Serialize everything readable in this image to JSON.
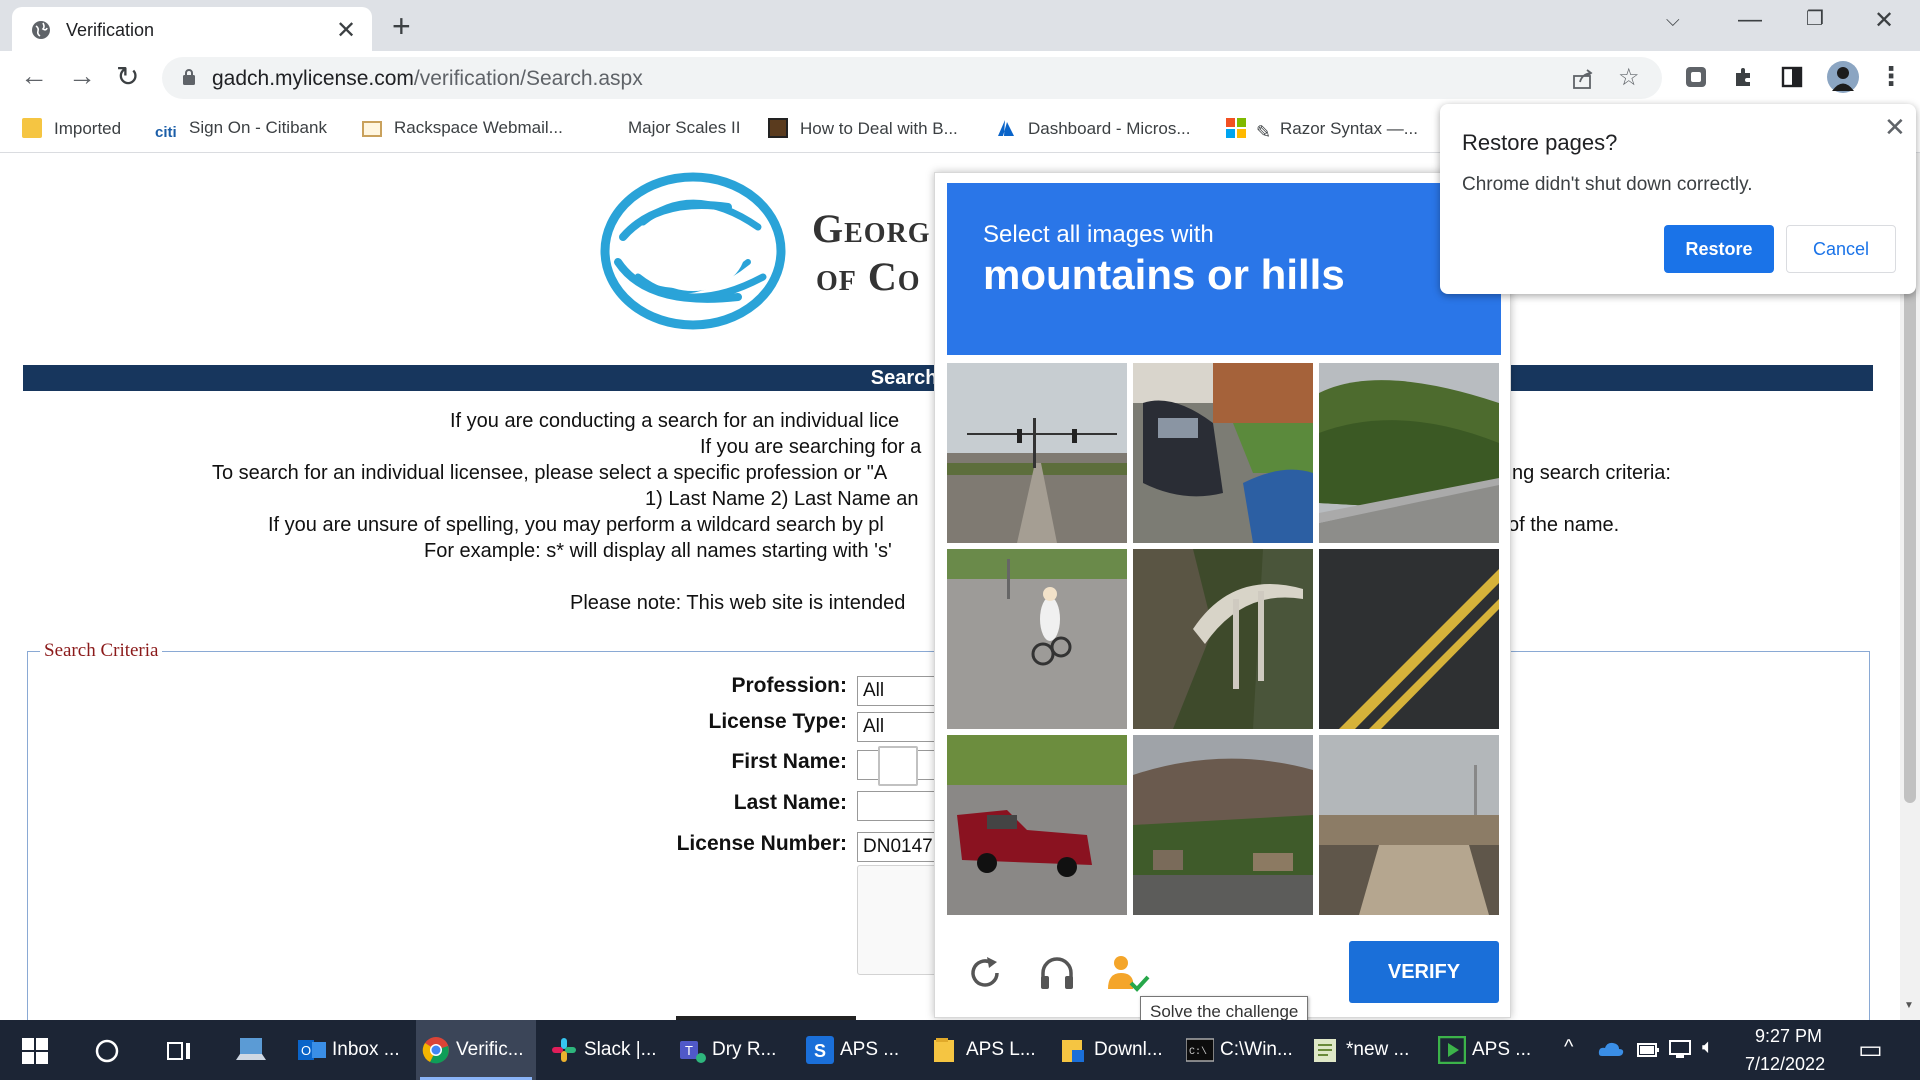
{
  "browser": {
    "tab_title": "Verification",
    "url_host": "gadch.mylicense.com",
    "url_path": "/verification/Search.aspx"
  },
  "bookmarks": [
    {
      "label": "Imported",
      "icon": "folder-icon"
    },
    {
      "label": "Sign On - Citibank",
      "icon": "citi-icon"
    },
    {
      "label": "Rackspace Webmail...",
      "icon": "mail-icon"
    },
    {
      "label": "Major Scales II",
      "icon": ""
    },
    {
      "label": "How to Deal with B...",
      "icon": "book-icon"
    },
    {
      "label": "Dashboard - Micros...",
      "icon": "azure-icon"
    },
    {
      "label": "Razor Syntax —...",
      "icon": "pen-icon"
    }
  ],
  "page": {
    "org_line1": "Georg",
    "org_line2": "of Co",
    "banner": "Search for a Pro",
    "intro": [
      "If you are conducting a search for an individual lice",
      "If you are searching for a",
      "To search for an individual licensee, please select a specific profession or \"A",
      "ng search criteria:",
      "1) Last Name 2) Last Name an",
      "If you are unsure of spelling, you may perform a wildcard search by pl",
      "of the name.",
      "For example: s* will display all names starting with 's'",
      "Please note: This web site is intended"
    ],
    "fieldset_legend": "Search Criteria",
    "fields": {
      "profession_label": "Profession:",
      "profession_value": "All",
      "license_type_label": "License Type:",
      "license_type_value": "All",
      "first_name_label": "First Name:",
      "first_name_value": "",
      "last_name_label": "Last Name:",
      "last_name_value": "",
      "license_number_label": "License Number:",
      "license_number_value": "DN0147"
    }
  },
  "captcha": {
    "prompt_pre": "Select all images with",
    "prompt_main": "mountains or hills",
    "verify_label": "VERIFY",
    "tooltip": "Solve the challenge",
    "tiles": [
      "road-traffic-light",
      "parked-cars",
      "green-hill",
      "cyclist-on-road",
      "bridge-canyon",
      "road-yellow-line",
      "red-pickup-truck",
      "town-with-hills",
      "overpass"
    ]
  },
  "restore_popup": {
    "title": "Restore pages?",
    "message": "Chrome didn't shut down correctly.",
    "restore_label": "Restore",
    "cancel_label": "Cancel"
  },
  "taskbar": {
    "items": [
      {
        "label": "Inbox ...",
        "icon": "outlook-icon"
      },
      {
        "label": "Verific...",
        "icon": "chrome-icon"
      },
      {
        "label": "Slack |...",
        "icon": "slack-icon"
      },
      {
        "label": "Dry R...",
        "icon": "teams-icon"
      },
      {
        "label": "APS ...",
        "icon": "app-icon"
      },
      {
        "label": "APS L...",
        "icon": "folder-icon"
      },
      {
        "label": "Downl...",
        "icon": "folder-icon"
      },
      {
        "label": "C:\\Win...",
        "icon": "cmd-icon"
      },
      {
        "label": "*new ...",
        "icon": "notepad-icon"
      },
      {
        "label": "APS ...",
        "icon": "play-icon"
      }
    ],
    "time": "9:27 PM",
    "date": "7/12/2022"
  },
  "colors": {
    "banner": "#17365d",
    "captcha_header": "#2a76e8",
    "verify_button": "#1a6fd9",
    "chrome_blue": "#1a73e8",
    "taskbar": "#1c2535"
  }
}
